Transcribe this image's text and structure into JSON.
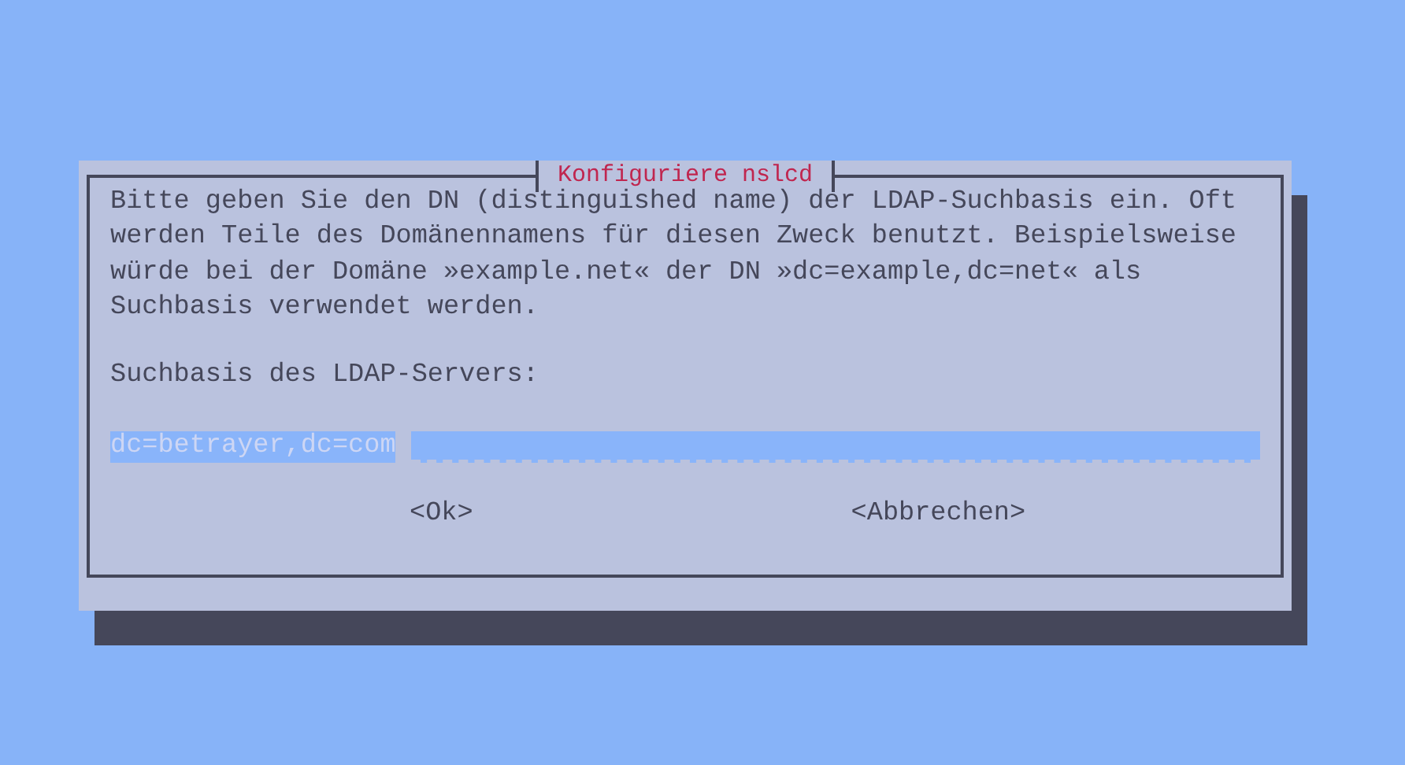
{
  "dialog": {
    "title": "Konfiguriere nslcd",
    "message_lines": [
      "Bitte geben Sie den DN (distinguished name) der LDAP-Suchbasis ein. Oft",
      "werden Teile des Domänennamens für diesen Zweck benutzt. Beispielsweise",
      "würde bei der Domäne »example.net« der DN »dc=example,dc=net« als",
      "Suchbasis verwendet werden."
    ],
    "prompt": "Suchbasis des LDAP-Servers:",
    "input": {
      "value": "dc=betrayer,dc=com",
      "selected": true
    },
    "buttons": [
      {
        "label": "<Ok>",
        "selected": false
      },
      {
        "label": "<Abbrechen>",
        "selected": false
      }
    ]
  }
}
